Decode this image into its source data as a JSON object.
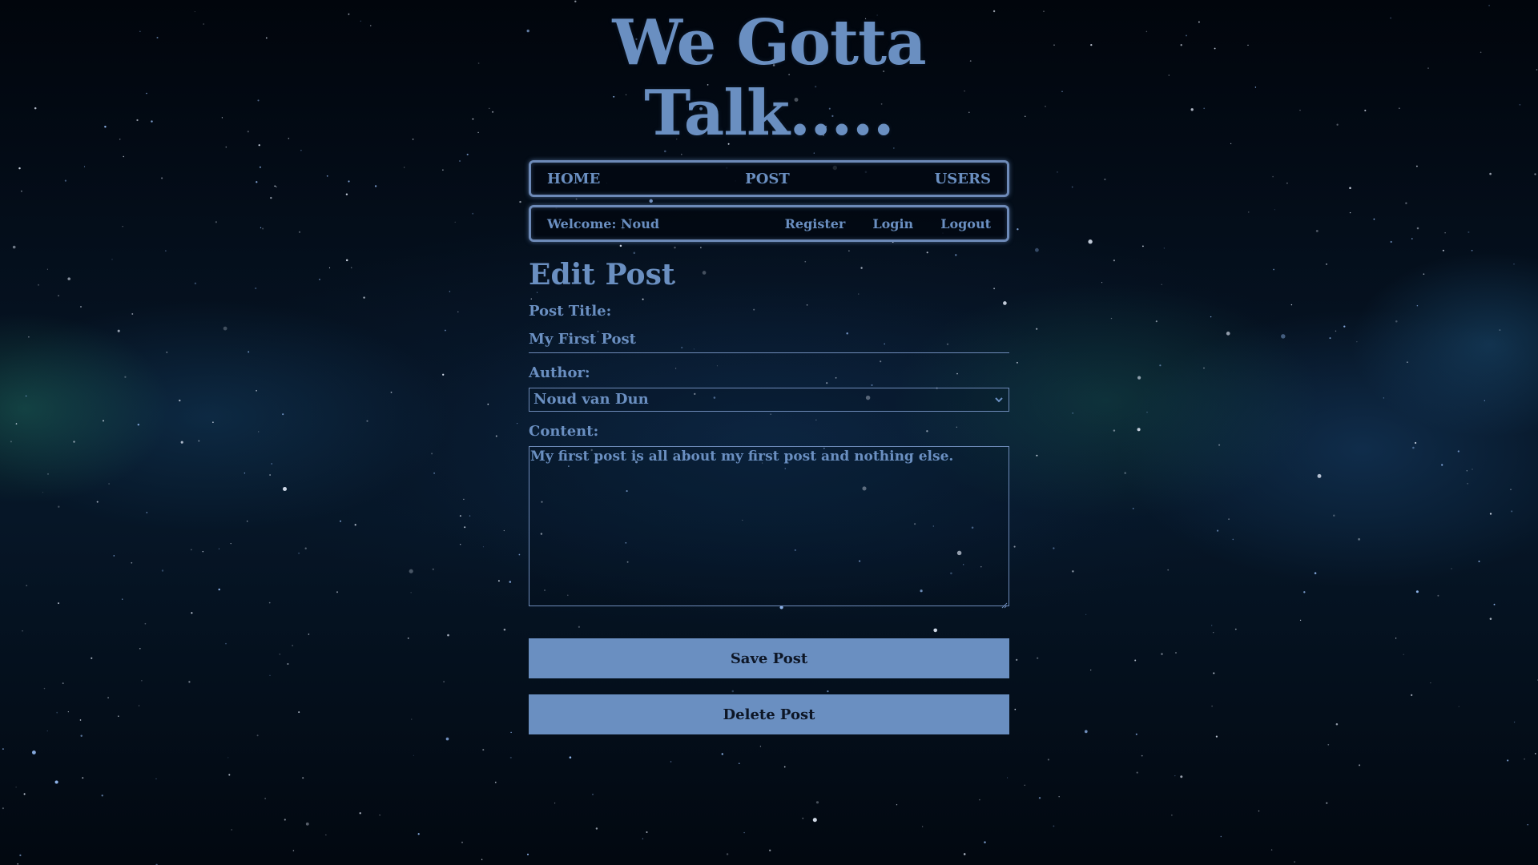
{
  "site": {
    "title": "We Gotta Talk....."
  },
  "nav": {
    "items": [
      {
        "label": "HOME"
      },
      {
        "label": "POST"
      },
      {
        "label": "USERS"
      }
    ]
  },
  "user_bar": {
    "welcome": "Welcome: Noud",
    "links": [
      {
        "label": "Register"
      },
      {
        "label": "Login"
      },
      {
        "label": "Logout"
      }
    ]
  },
  "form": {
    "heading": "Edit Post",
    "title_label": "Post Title:",
    "title_value": "My First Post",
    "author_label": "Author:",
    "author_selected": "Noud van Dun",
    "author_chevron_icon": "chevron-down-icon",
    "content_label": "Content:",
    "content_value": "My first post is all about my first post and nothing else.",
    "save_label": "Save Post",
    "delete_label": "Delete Post"
  },
  "colors": {
    "accent": "#6a8fc1",
    "border": "#6d8ab8",
    "button_text": "#0d1626",
    "background": "#020812"
  }
}
